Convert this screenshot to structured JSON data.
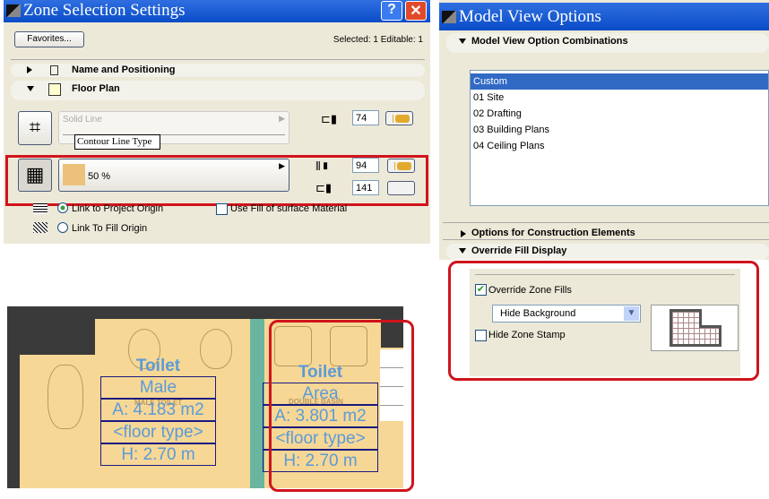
{
  "zone_dialog": {
    "title": "Zone Selection Settings",
    "favorites_label": "Favorites...",
    "selection_status": "Selected: 1 Editable: 1",
    "sections": [
      {
        "label": "Name and Positioning",
        "expanded": false
      },
      {
        "label": "Floor Plan",
        "expanded": true
      }
    ],
    "contour_line_type": "Solid Line",
    "tooltip": "Contour Line Type",
    "contour_pen": "74",
    "fill_label": "50 %",
    "fill_pen": "94",
    "fill_bg_pen": "141",
    "radio_project_origin": "Link to Project Origin",
    "radio_fill_origin": "Link To Fill Origin",
    "use_fill_checkbox": "Use Fill of surface Material",
    "colors": {
      "accent_fill": "#e2aa2c",
      "highlight": "#d0141c"
    }
  },
  "model_view": {
    "title": "Model View Options",
    "section_combinations": "Model View Option Combinations",
    "combinations": [
      "Custom",
      "01 Site",
      "02 Drafting",
      "03 Building Plans",
      "04 Ceiling Plans"
    ],
    "selected": "Custom",
    "section_construction": "Options for Construction Elements",
    "section_override": "Override Fill Display",
    "override_zone_fills": {
      "label": "Override Zone Fills",
      "checked": true
    },
    "fill_mode": "Hide Background",
    "hide_zone_stamp": {
      "label": "Hide Zone Stamp",
      "checked": false
    }
  },
  "floor_plan": {
    "zones": [
      {
        "title": "Toilet",
        "rows": [
          "Male",
          "A: 4.183 m2",
          "<floor type>",
          "H: 2.70 m"
        ],
        "label": "MALE TOILET"
      },
      {
        "title": "Toilet",
        "rows": [
          "Area",
          "A: 3.801 m2",
          "<floor type>",
          "H: 2.70 m"
        ],
        "label": "DOUBLE BASIN"
      }
    ]
  }
}
